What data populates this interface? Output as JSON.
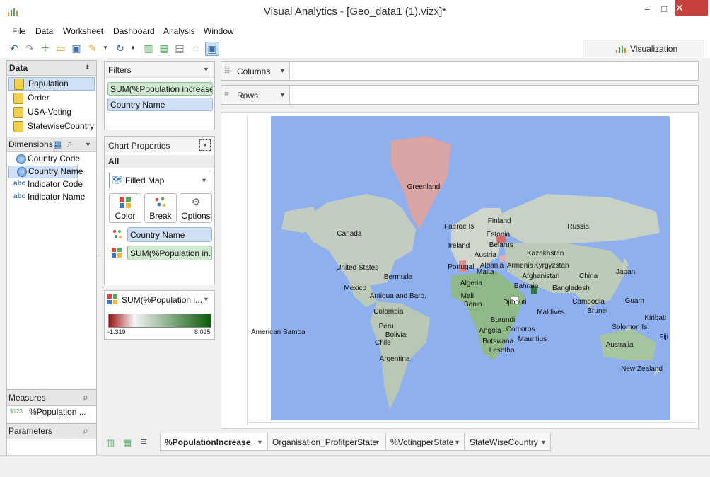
{
  "window": {
    "title": "Visual Analytics - [Geo_data1 (1).vizx]*",
    "minimize": "–",
    "maximize": "□",
    "close": "✕"
  },
  "menu": [
    "File",
    "Data",
    "Worksheet",
    "Dashboard",
    "Analysis",
    "Window"
  ],
  "toolbar": {
    "icons": [
      "undo-icon",
      "redo-icon",
      "new-icon",
      "open-icon",
      "save-icon",
      "wand-icon",
      "refresh-icon",
      "add-chart-icon",
      "add-grid-icon",
      "bar-chart-icon",
      "lasso-icon",
      "select-icon"
    ]
  },
  "viz_tab": {
    "label": "Visualization"
  },
  "data_panel": {
    "title": "Data",
    "sources": [
      "Population",
      "Order",
      "USA-Voting",
      "StatewiseCountry"
    ]
  },
  "dimensions": {
    "title": "Dimensions",
    "items": [
      {
        "type": "geo",
        "label": "Country Code"
      },
      {
        "type": "geo",
        "label": "Country Name"
      },
      {
        "type": "abc",
        "label": "Indicator Code"
      },
      {
        "type": "abc",
        "label": "Indicator Name"
      }
    ],
    "abc": "abc"
  },
  "measures": {
    "title": "Measures",
    "item": "%Population ...",
    "prefix": "$123"
  },
  "parameters": {
    "title": "Parameters"
  },
  "filters": {
    "title": "Filters",
    "items": [
      "SUM(%Population increase...",
      "Country Name"
    ]
  },
  "chart_properties": {
    "title": "Chart Properties",
    "all": "All",
    "chart_type": "Filled Map",
    "buttons": [
      "Color",
      "Break",
      "Options"
    ],
    "marks": [
      "Country Name",
      "SUM(%Population in..."
    ]
  },
  "legend": {
    "title": "SUM(%Population i...",
    "min": "-1.319",
    "max": "8.095",
    "colors": {
      "low": "#a01010",
      "mid": "#f5f5f5",
      "high": "#0b5a0b"
    }
  },
  "shelves": {
    "columns": "Columns",
    "rows": "Rows"
  },
  "map": {
    "ocean": "#8fb0ee",
    "land_default": "#bcc9b8",
    "labels": [
      "Greenland",
      "Finland",
      "Russia",
      "Canada",
      "Faeroe Is.",
      "Estonia",
      "Belarus",
      "Ireland",
      "Austria",
      "Kazakhstan",
      "Portugal",
      "Albania",
      "Armenia",
      "Kyrgyzstan",
      "Malta",
      "Afghanistan",
      "United States",
      "Bermuda",
      "Algeria",
      "China",
      "Japan",
      "Bahrain",
      "Mexico",
      "Bangladesh",
      "Antigua and Barb.",
      "Mali",
      "Guam",
      "Djibouti",
      "Cambodia",
      "Benin",
      "Colombia",
      "Maldives",
      "Brunei",
      "Kiribati",
      "Burundi",
      "Solomon Is.",
      "Peru",
      "Comoros",
      "American Samoa",
      "Angola",
      "Fiji",
      "Bolivia",
      "Mauritius",
      "Chile",
      "Botswana",
      "Australia",
      "Lesotho",
      "Argentina",
      "New Zealand"
    ]
  },
  "sheets": [
    "%PopulationIncrease",
    "Organisation_ProfitperState",
    "%VotingperState",
    "StateWiseCountry"
  ]
}
